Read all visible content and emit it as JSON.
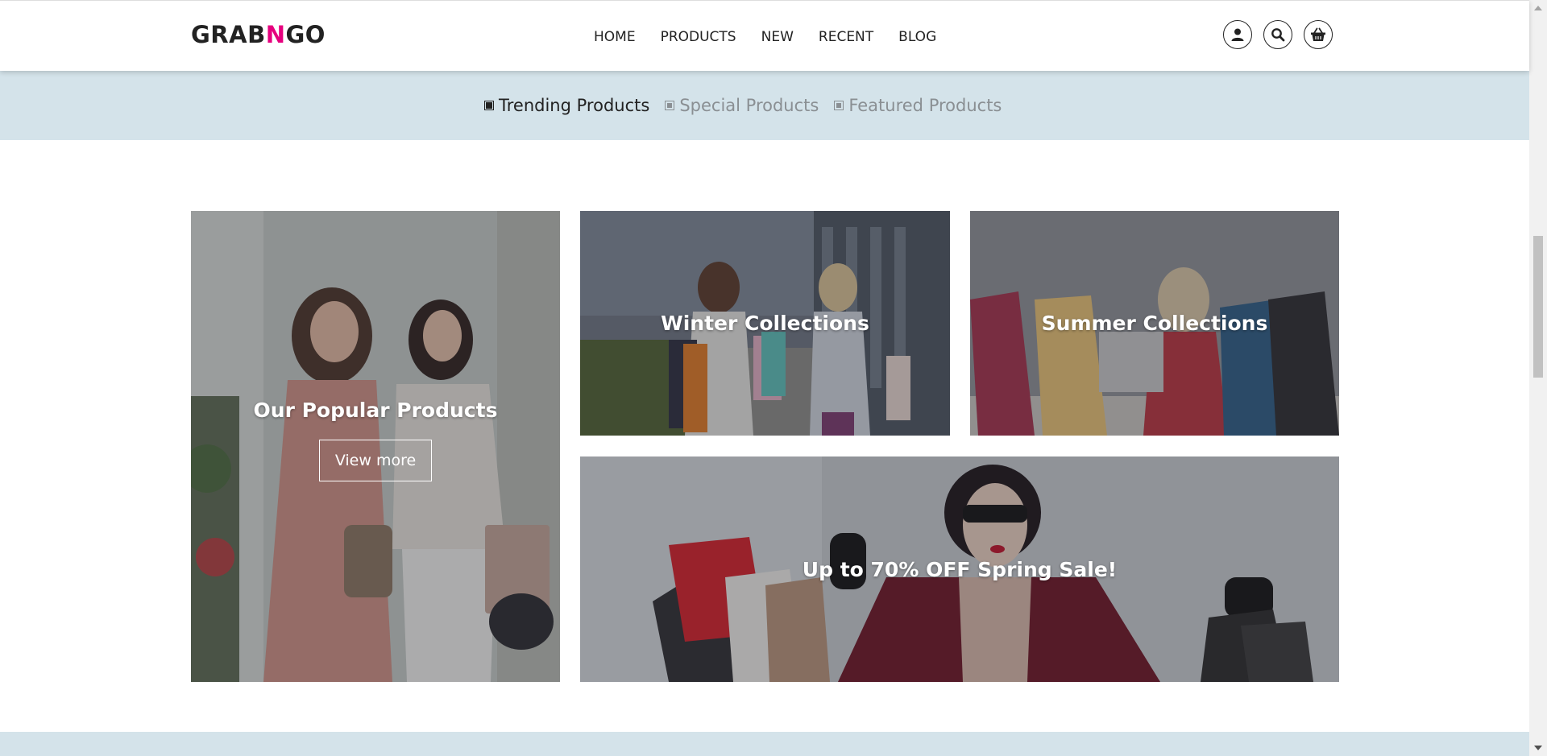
{
  "brand": {
    "prefix": "GRAB",
    "accent": "N",
    "suffix": "GO",
    "accent_color": "#e6007e"
  },
  "nav": {
    "items": [
      "HOME",
      "PRODUCTS",
      "NEW",
      "RECENT",
      "BLOG"
    ]
  },
  "header_icons": [
    "user-icon",
    "search-icon",
    "basket-icon"
  ],
  "tabs": {
    "items": [
      {
        "label": "Trending Products",
        "active": true
      },
      {
        "label": "Special Products",
        "active": false
      },
      {
        "label": "Featured Products",
        "active": false
      }
    ]
  },
  "banners": {
    "popular": {
      "title": "Our Popular Products",
      "button": "View more"
    },
    "winter": {
      "title": "Winter Collections"
    },
    "summer": {
      "title": "Summer Collections"
    },
    "sale": {
      "title": "Up to 70% OFF Spring Sale!"
    }
  },
  "colors": {
    "tab_bar_bg": "#d4e3ea",
    "accent": "#e6007e"
  }
}
